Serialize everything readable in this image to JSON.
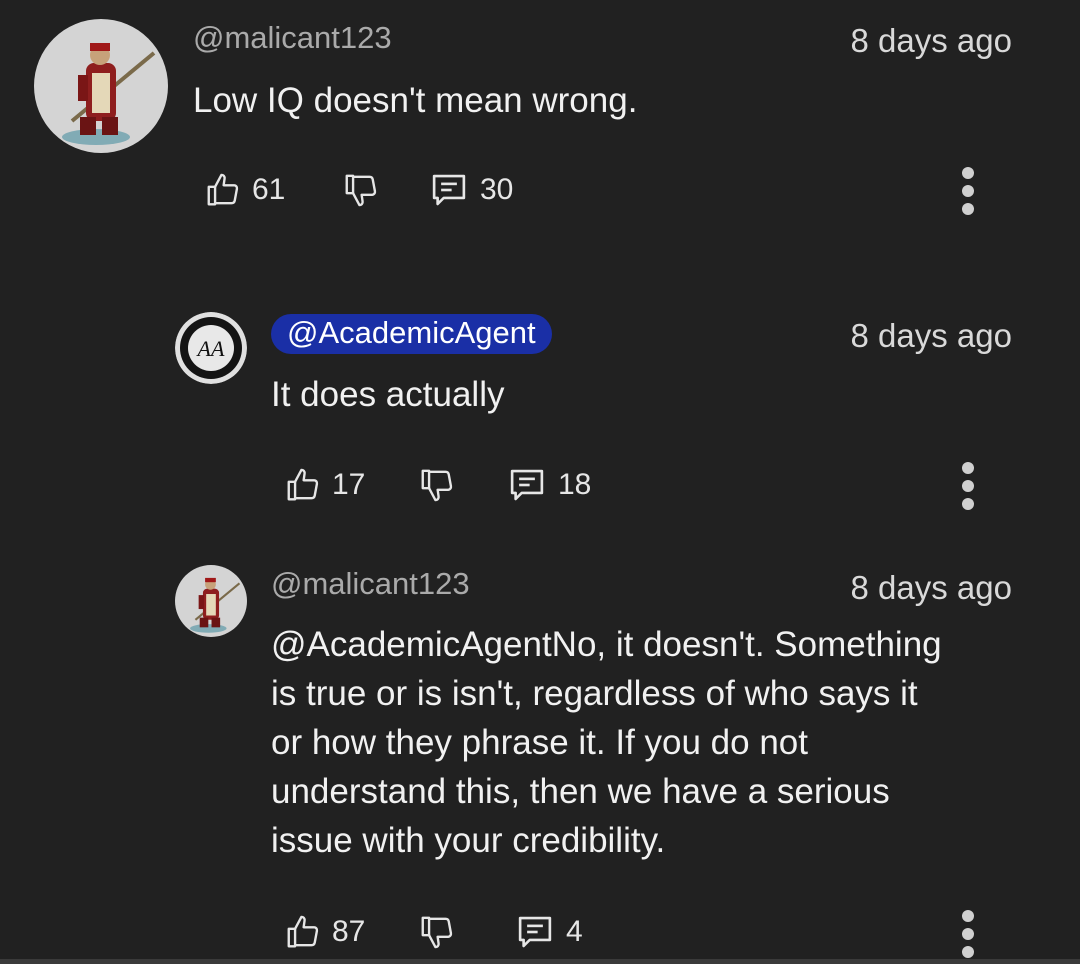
{
  "comments": [
    {
      "handle": "@malicant123",
      "time": "8 days ago",
      "text": [
        "Low IQ doesn't mean wrong."
      ],
      "likes": "61",
      "replies": "30"
    },
    {
      "handle": "@AcademicAgent",
      "avatar_text": "AA",
      "time": "8 days ago",
      "text": [
        "It does actually"
      ],
      "likes": "17",
      "replies": "18"
    },
    {
      "handle": "@malicant123",
      "time": "8 days ago",
      "text": [
        "@AcademicAgentNo, it doesn't. Something",
        "is true or is isn't, regardless of who says it",
        "or how they phrase it. If you do not",
        "understand this, then we have a serious",
        "issue with your credibility."
      ],
      "likes": "87",
      "replies": "4"
    }
  ],
  "icons": {
    "like": "thumbs-up-icon",
    "dislike": "thumbs-down-icon",
    "reply": "comment-icon",
    "more": "more-vertical-icon"
  },
  "colors": {
    "background": "#212121",
    "creator_badge": "#1a2fa6"
  }
}
